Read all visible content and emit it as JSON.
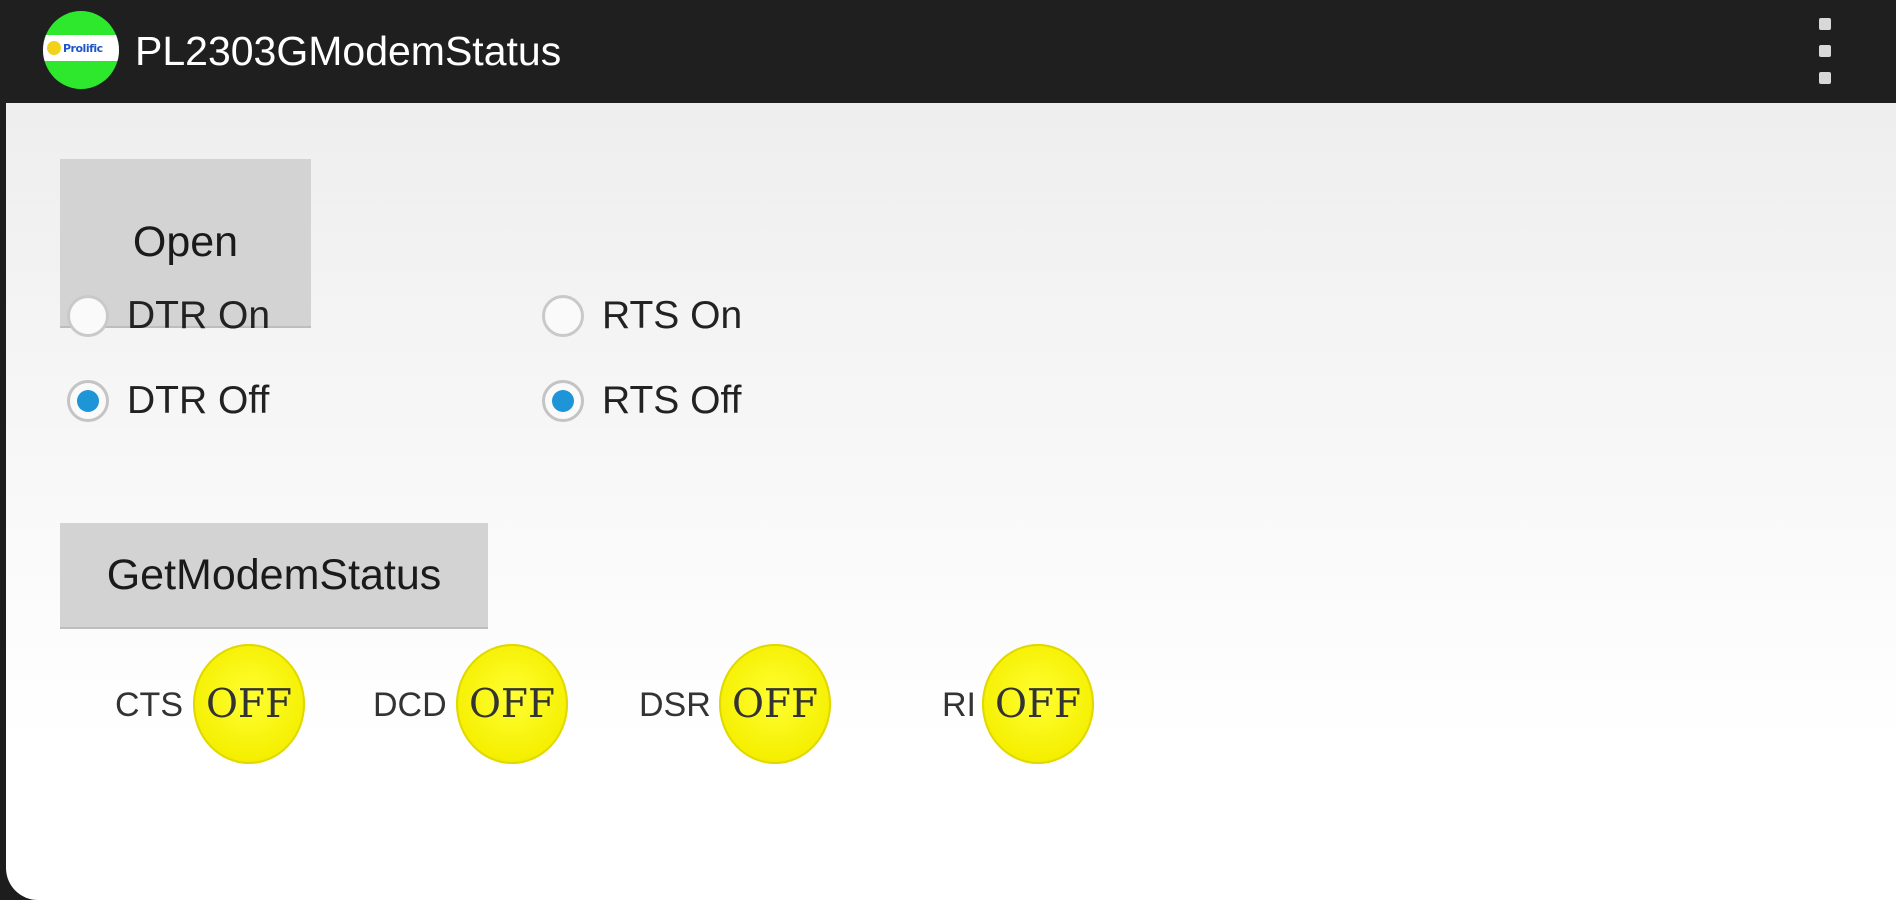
{
  "app_bar": {
    "title": "PL2303GModemStatus",
    "icon_text": "Prolific"
  },
  "buttons": {
    "open": "Open",
    "get_modem_status": "GetModemStatus"
  },
  "dtr": {
    "on_label": "DTR On",
    "off_label": "DTR Off",
    "selected": "off"
  },
  "rts": {
    "on_label": "RTS On",
    "off_label": "RTS Off",
    "selected": "off"
  },
  "status": {
    "cts": {
      "label": "CTS",
      "value": "OFF"
    },
    "dcd": {
      "label": "DCD",
      "value": "OFF"
    },
    "dsr": {
      "label": "DSR",
      "value": "OFF"
    },
    "ri": {
      "label": "RI",
      "value": "OFF"
    }
  },
  "colors": {
    "accent": "#1e95d6",
    "led": "#f5ef00",
    "titlebar": "#1f1f1f"
  }
}
